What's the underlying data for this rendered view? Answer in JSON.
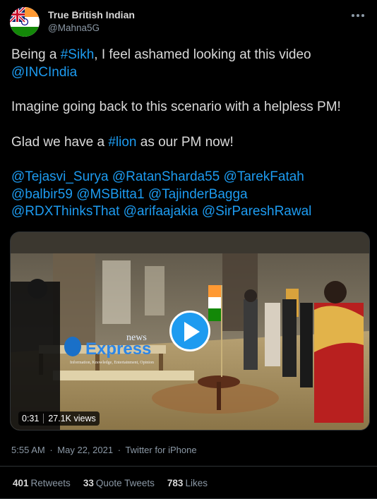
{
  "author": {
    "name": "True British Indian",
    "handle": "@Mahna5G",
    "avatar_icon": "uk-india-flag-avatar"
  },
  "tweet": {
    "lines": {
      "l1_a": "Being a ",
      "l1_tag": "#Sikh",
      "l1_b": ", I feel ashamed looking at this video",
      "l2_mention": "@INCIndia",
      "l3": "Imagine going back to this scenario with a helpless PM!",
      "l4_a": "Glad we have a ",
      "l4_tag": "#lion",
      "l4_b": " as our PM now!",
      "mentions": [
        "@Tejasvi_Surya",
        "@RatanSharda55",
        "@TarekFatah",
        "@balbir59",
        "@MSBitta1",
        "@TajinderBagga",
        "@RDXThinksThat",
        "@arifaajakia",
        "@SirPareshRawal"
      ]
    }
  },
  "video": {
    "duration": "0:31",
    "views": "27.1K views",
    "watermark_top": "news",
    "watermark_brand": "Express",
    "watermark_tagline": "Information, Knowledge, Entertainment, Opinion"
  },
  "meta": {
    "time": "5:55 AM",
    "dot": "·",
    "date": "May 22, 2021",
    "source": "Twitter for iPhone"
  },
  "stats": {
    "retweets_count": "401",
    "retweets_label": "Retweets",
    "quotes_count": "33",
    "quotes_label": "Quote Tweets",
    "likes_count": "783",
    "likes_label": "Likes"
  },
  "colors": {
    "background": "#000000",
    "text": "#d9d9d9",
    "link": "#1d9bf0",
    "secondary": "#8b98a5"
  }
}
